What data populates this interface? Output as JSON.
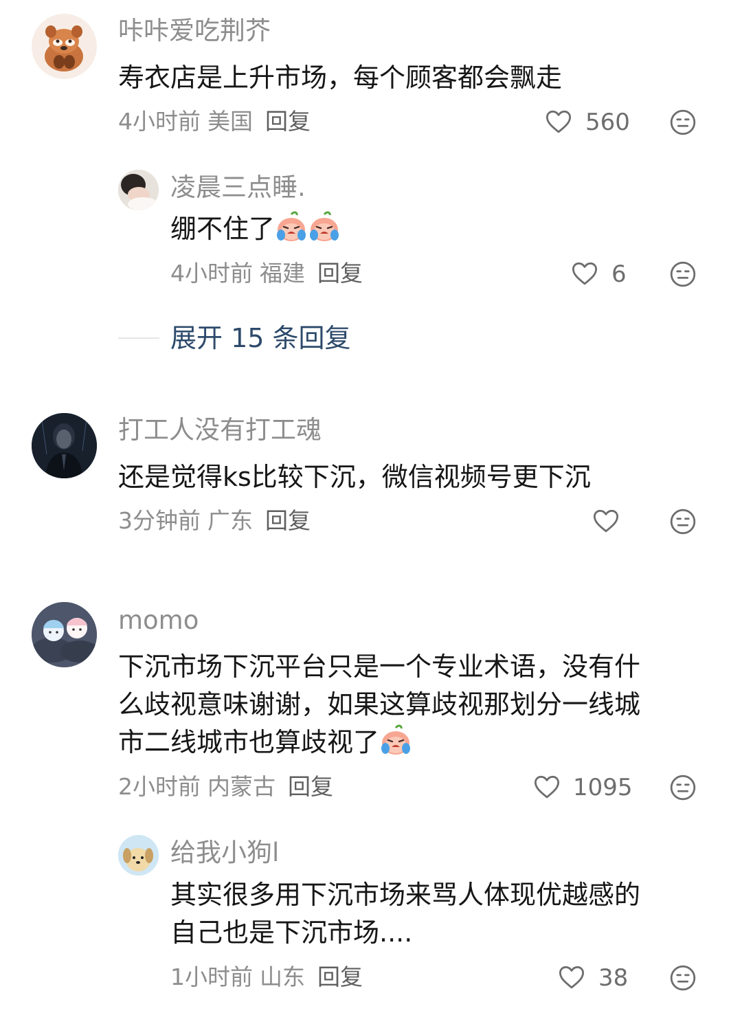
{
  "comments": [
    {
      "username": "咔咔爱吃荆芥",
      "text": "寿衣店是上升市场，每个顾客都会飘走",
      "time": "4小时前",
      "location": "美国",
      "reply": "回复",
      "likes": "560",
      "reply_item": {
        "username": "凌晨三点睡.",
        "text": "绷不住了",
        "emojis": [
          "crying-peach-emoji",
          "crying-peach-emoji"
        ],
        "time": "4小时前",
        "location": "福建",
        "reply": "回复",
        "likes": "6"
      },
      "expand_label": "展开 15 条回复"
    },
    {
      "username": "打工人没有打工魂",
      "text": "还是觉得ks比较下沉，微信视频号更下沉",
      "time": "3分钟前",
      "location": "广东",
      "reply": "回复",
      "likes": ""
    },
    {
      "username": "momo",
      "text_lines": [
        "下沉市场下沉平台只是一个专业术语，没有什",
        "么歧视意味谢谢，如果这算歧视那划分一线城",
        "市二线城市也算歧视了"
      ],
      "emojis": [
        "crying-peach-emoji"
      ],
      "time": "2小时前",
      "location": "内蒙古",
      "reply": "回复",
      "likes": "1095",
      "reply_item": {
        "username": "给我小狗l",
        "text_lines": [
          "其实很多用下沉市场来骂人体现优越感的",
          "自己也是下沉市场...."
        ],
        "time": "1小时前",
        "location": "山东",
        "reply": "回复",
        "likes": "38"
      }
    }
  ],
  "icons": {
    "like": "heart-outline-icon",
    "dislike": "meh-face-icon"
  },
  "colors": {
    "text": "#161616",
    "secondary": "#8d8d8d",
    "link": "#2d4a6b",
    "background": "#ffffff"
  }
}
